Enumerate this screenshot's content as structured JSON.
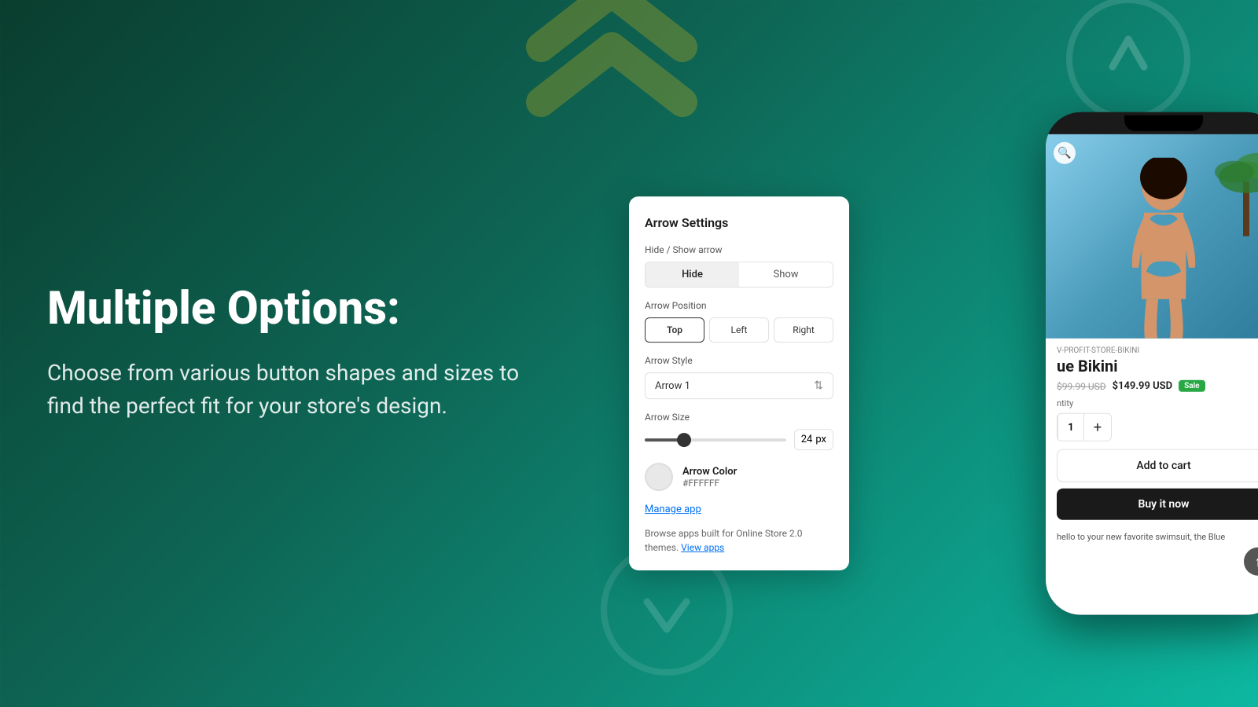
{
  "page": {
    "background_from": "#0a3d2e",
    "background_to": "#0db8a0"
  },
  "left": {
    "title": "Multiple Options:",
    "description": "Choose from various button shapes and sizes to find the perfect fit for your store's design."
  },
  "settings_panel": {
    "title": "Arrow Settings",
    "hide_show": {
      "label": "Hide / Show arrow",
      "hide_label": "Hide",
      "show_label": "Show",
      "active": "hide"
    },
    "position": {
      "label": "Arrow Position",
      "options": [
        "Top",
        "Left",
        "Right"
      ],
      "active": "Top"
    },
    "style": {
      "label": "Arrow Style",
      "value": "Arrow 1"
    },
    "size": {
      "label": "Arrow Size",
      "value": "24",
      "unit": "px"
    },
    "color": {
      "label": "Arrow Color",
      "hex": "#FFFFFF"
    },
    "manage_link": "Manage app",
    "browse_text": "Browse apps built for Online Store 2.0 themes.",
    "view_apps_link": "View apps"
  },
  "phone": {
    "store_name": "V-PROFIT-STORE-BIKINI",
    "product_name": "ue Bikini",
    "price_original": "$99.99 USD",
    "price_current": "$149.99 USD",
    "sale_badge": "Sale",
    "quantity_label": "ntity",
    "quantity_value": "1",
    "add_to_cart": "Add to cart",
    "buy_now": "Buy it now",
    "description": "hello to your new favorite swimsuit, the Blue"
  }
}
